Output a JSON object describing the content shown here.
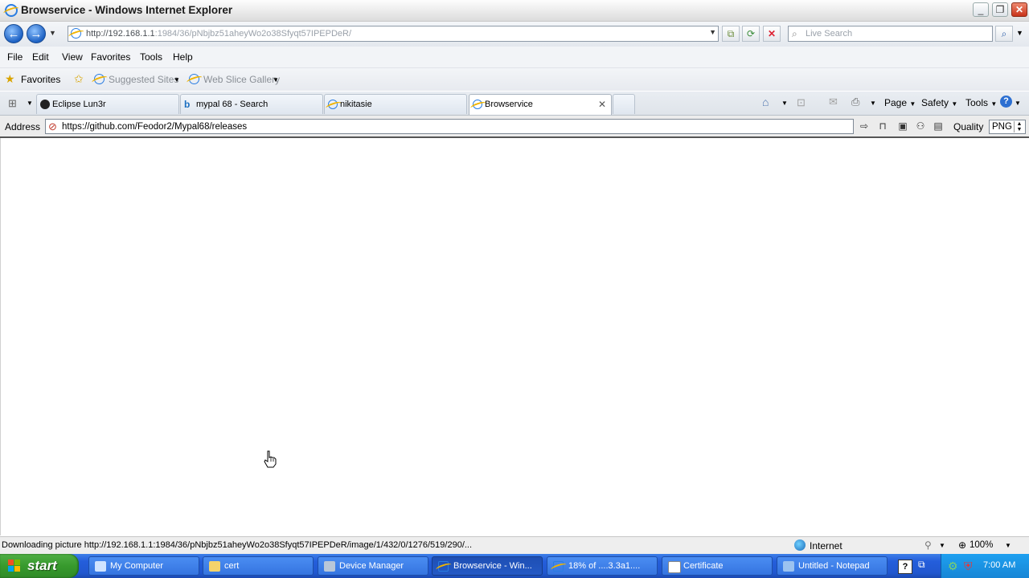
{
  "window": {
    "title": "Browservice - Windows Internet Explorer"
  },
  "navbar": {
    "url_host": "http://192.168.1.1",
    "url_path": ":1984/36/pNbjbz51aheyWo2o38Sfyqt57IPEPDeR/",
    "search_placeholder": "Live Search"
  },
  "menu": {
    "items": [
      "File",
      "Edit",
      "View",
      "Favorites",
      "Tools",
      "Help"
    ]
  },
  "favbar": {
    "favorites": "Favorites",
    "suggested": "Suggested Sites",
    "slice": "Web Slice Gallery"
  },
  "tabs": [
    {
      "label": "Eclipse Lun3r"
    },
    {
      "label": "mypal 68 - Search"
    },
    {
      "label": "nikitasie"
    },
    {
      "label": "Browservice"
    }
  ],
  "commandbar": {
    "page": "Page",
    "safety": "Safety",
    "tools": "Tools"
  },
  "addressbar": {
    "label": "Address",
    "value": "https://github.com/Feodor2/Mypal68/releases",
    "quality_label": "Quality",
    "quality_value": "PNG"
  },
  "status": {
    "message": "Downloading picture http://192.168.1.1:1984/36/pNbjbz51aheyWo2o38Sfyqt57IPEPDeR/image/1/432/0/1276/519/290/...",
    "zone": "Internet",
    "zoom": "100%"
  },
  "taskbar": {
    "start": "start",
    "items": [
      {
        "label": "My Computer"
      },
      {
        "label": "cert"
      },
      {
        "label": "Device Manager"
      },
      {
        "label": "Browservice - Win..."
      },
      {
        "label": "18% of ....3.3a1...."
      },
      {
        "label": "Certificate"
      },
      {
        "label": "Untitled - Notepad"
      }
    ],
    "clock": "7:00 AM"
  },
  "colors": {
    "taskbar": "#245edb",
    "start": "#379a2d",
    "ie_blue": "#2a7de1"
  },
  "icons": [
    "ie-icon",
    "back-arrow-icon",
    "forward-arrow-icon",
    "refresh-icon",
    "stop-icon",
    "search-icon",
    "star-icon",
    "home-icon",
    "feed-icon",
    "print-icon",
    "help-icon",
    "cursor-hand-icon"
  ]
}
